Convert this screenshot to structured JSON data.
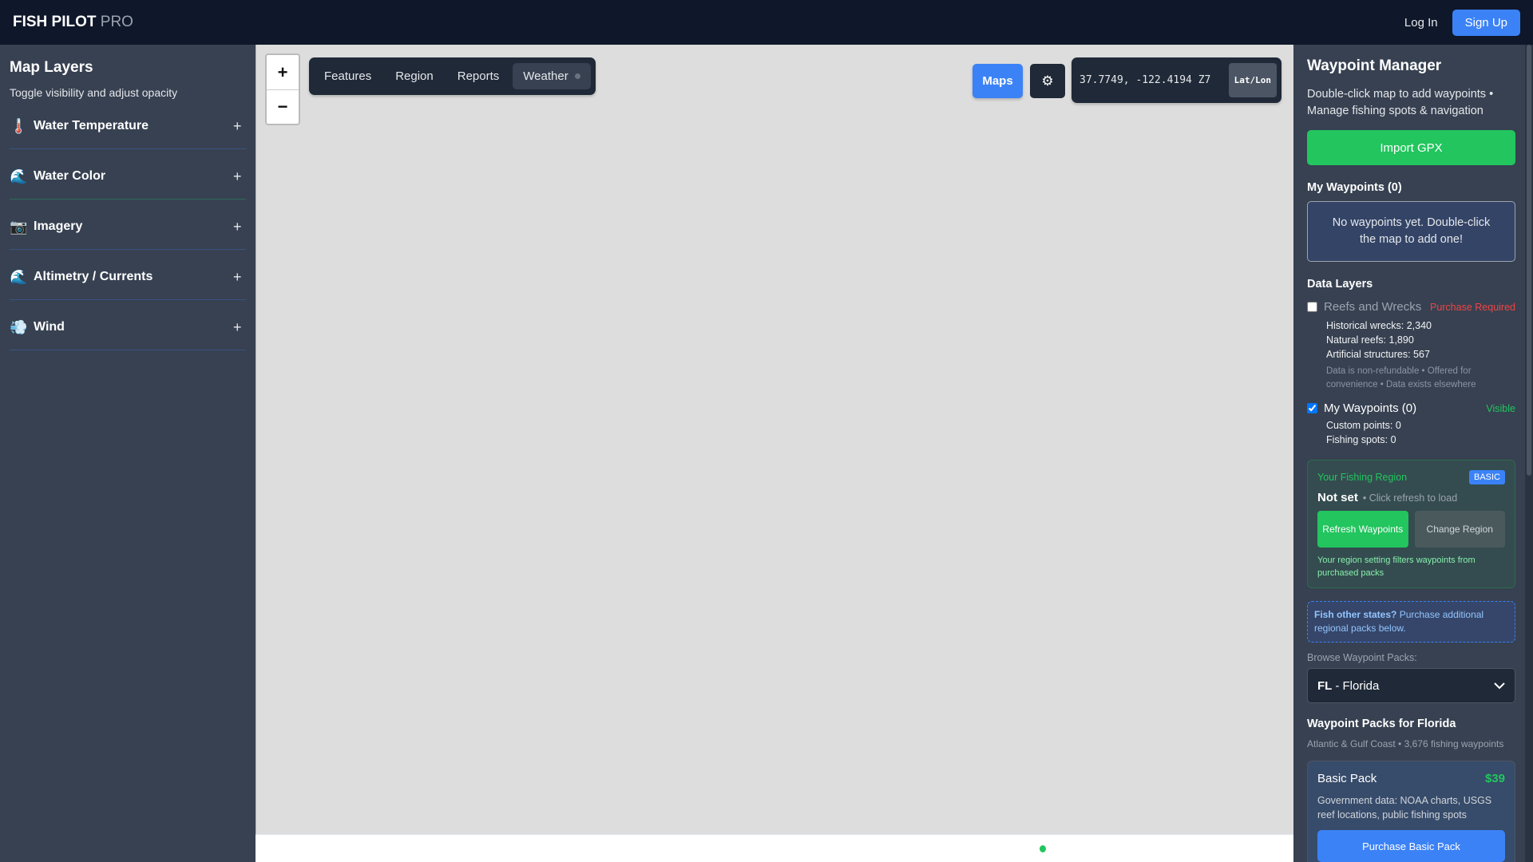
{
  "header": {
    "brand": "FISH PILOT",
    "brand_suffix": "PRO",
    "login": "Log In",
    "signup": "Sign Up"
  },
  "left": {
    "title": "Map Layers",
    "subtitle": "Toggle visibility and adjust opacity",
    "layers": [
      {
        "icon": "🌡️",
        "label": "Water Temperature",
        "action": "+"
      },
      {
        "icon": "🌊",
        "label": "Water Color",
        "action": "+"
      },
      {
        "icon": "📷",
        "label": "Imagery",
        "action": "+"
      },
      {
        "icon": "🌊",
        "label": "Altimetry / Currents",
        "action": "+"
      },
      {
        "icon": "💨",
        "label": "Wind",
        "action": "+"
      }
    ]
  },
  "map": {
    "zoom_in": "+",
    "zoom_out": "−",
    "tabs": [
      "Features",
      "Region",
      "Reports",
      "Weather"
    ],
    "maps_button": "Maps",
    "gear": "⚙",
    "coords": "37.7749, -122.4194 Z7",
    "coord_format": "Lat/Lon"
  },
  "right": {
    "title": "Waypoint Manager",
    "desc": "Double-click map to add waypoints • Manage fishing spots & navigation",
    "import": "Import GPX",
    "my_waypoints": "My Waypoints (0)",
    "empty": "No waypoints yet. Double-click the map to add one!",
    "data_layers": "Data Layers",
    "reefs": {
      "label": "Reefs and Wrecks",
      "status": "Purchase Required",
      "stats": [
        "Historical wrecks: 2,340",
        "Natural reefs: 1,890",
        "Artificial structures: 567"
      ],
      "note": "Data is non-refundable • Offered for convenience • Data exists elsewhere"
    },
    "mywp": {
      "label": "My Waypoints (0)",
      "status": "Visible",
      "stats": [
        "Custom points: 0",
        "Fishing spots: 0"
      ]
    },
    "region": {
      "label": "Your Fishing Region",
      "badge": "BASIC",
      "value": "Not set",
      "hint": "• Click refresh to load",
      "refresh": "Refresh Waypoints",
      "change": "Change Region",
      "foot": "Your region setting filters waypoints from purchased packs"
    },
    "other": {
      "bold": "Fish other states?",
      "text": " Purchase additional regional packs below."
    },
    "browse_label": "Browse Waypoint Packs:",
    "select": {
      "code": "FL",
      "name": "- Florida"
    },
    "packs_title": "Waypoint Packs for Florida",
    "packs_sub": "Atlantic & Gulf Coast • 3,676 fishing waypoints",
    "pack": {
      "name": "Basic Pack",
      "price": "$39",
      "desc": "Government data: NOAA charts, USGS reef locations, public fishing spots",
      "buy": "Purchase Basic Pack"
    }
  }
}
